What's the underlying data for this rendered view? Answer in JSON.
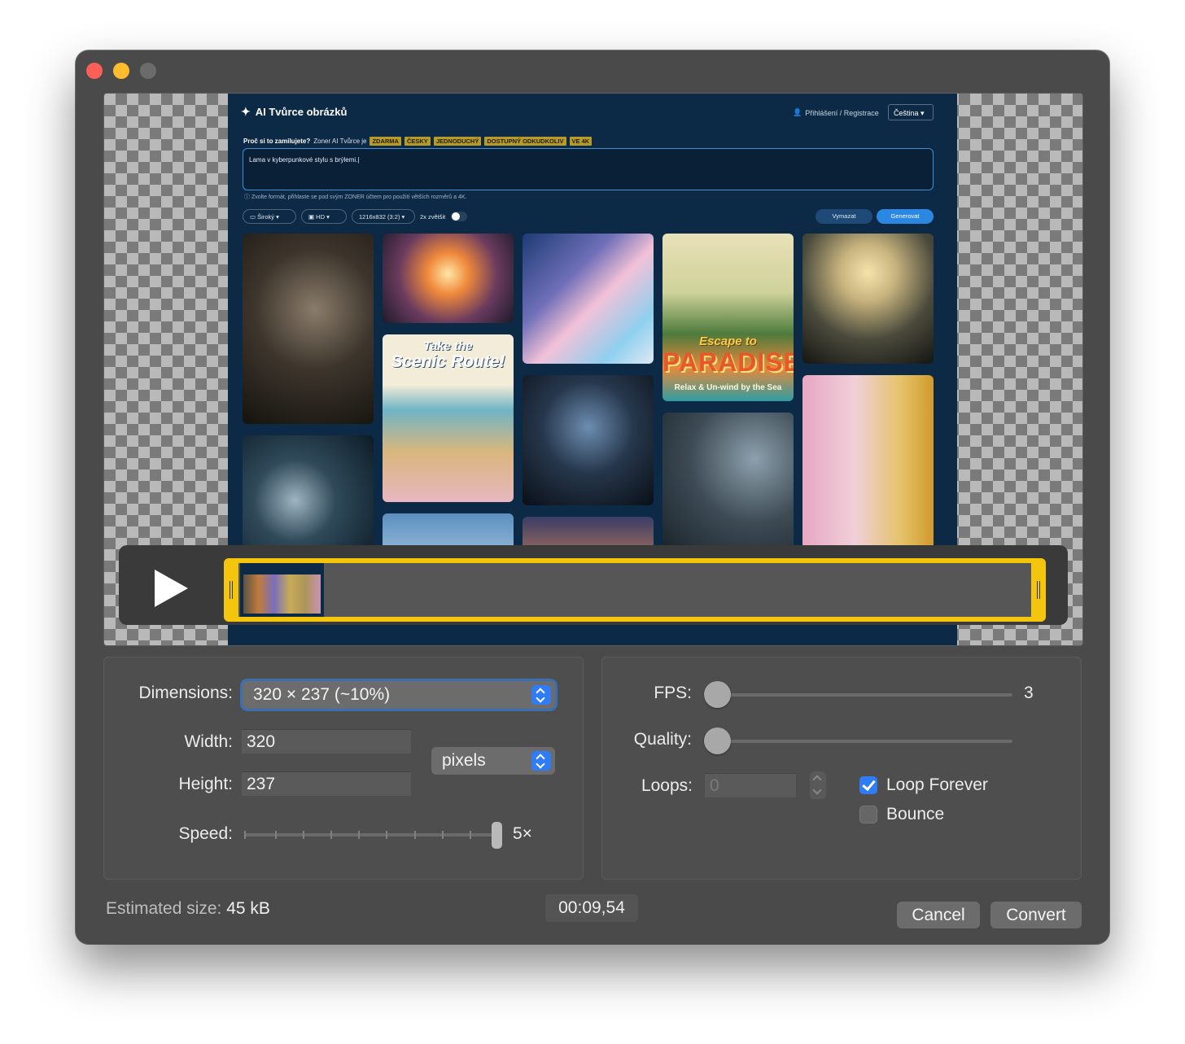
{
  "window": {
    "title": ""
  },
  "preview": {
    "site_title": "AI Tvůrce obrázků",
    "login_label": "Přihlášení / Registrace",
    "language_label": "Čeština",
    "why_question": "Proč si to zamilujete?",
    "why_text": "Zoner AI Tvůrce je",
    "tags": [
      "ZDARMA",
      "ČESKY",
      "JEDNODUCHÝ",
      "DOSTUPNÝ ODKUDKOLIV",
      "VE 4K"
    ],
    "prompt_text": "Lama v kyberpunkové stylu s brýlemi.",
    "note_text": "Zvolte formát, přihlaste se pod svým ZONER účtem pro použití větších rozměrů a 4K.",
    "options": [
      "Široký",
      "HD",
      "1216x832 (3:2)"
    ],
    "upscale_label": "2x zvětšit",
    "clear_button": "Vymazat",
    "generate_button": "Generovat",
    "poster_1_line_1": "Take the",
    "poster_1_line_2": "Scenic Route!",
    "poster_2_line_1": "Escape to",
    "poster_2_line_2": "PARADISE",
    "poster_2_line_3": "Relax & Un-wind by the Sea"
  },
  "settings": {
    "dimensions_label": "Dimensions:",
    "dimensions_value": "320 × 237 (~10%)",
    "width_label": "Width:",
    "width_value": "320",
    "height_label": "Height:",
    "height_value": "237",
    "unit_value": "pixels",
    "speed_label": "Speed:",
    "speed_value": "5×",
    "fps_label": "FPS:",
    "fps_value": "3",
    "quality_label": "Quality:",
    "loops_label": "Loops:",
    "loops_value": "0",
    "loop_forever_label": "Loop Forever",
    "loop_forever_checked": true,
    "bounce_label": "Bounce",
    "bounce_checked": false
  },
  "footer": {
    "estimated_label": "Estimated size:",
    "estimated_value": "45 kB",
    "duration": "00:09,54",
    "cancel_button": "Cancel",
    "convert_button": "Convert"
  },
  "colors": {
    "accent": "#2f7cf6",
    "timeline": "#f4c50d",
    "window_bg": "#4a4a4a"
  }
}
